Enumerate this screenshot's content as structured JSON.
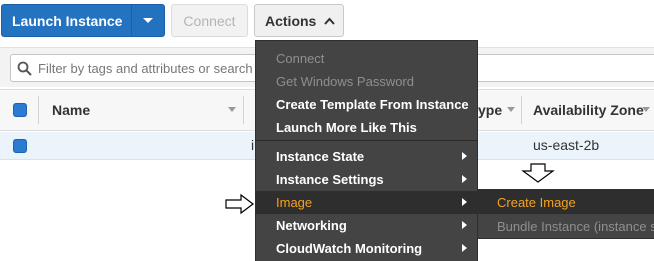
{
  "toolbar": {
    "launch_label": "Launch Instance",
    "connect_label": "Connect",
    "actions_label": "Actions"
  },
  "filter": {
    "placeholder": "Filter by tags and attributes or search by keyword"
  },
  "table": {
    "columns": [
      "Name",
      "Instance Type",
      "Availability Zone"
    ],
    "visible_column_labels": {
      "name": "Name",
      "type_fragment": "ype",
      "zone": "Availability Zone"
    },
    "row": {
      "id_fragment": "i",
      "availability_zone": "us-east-2b"
    }
  },
  "actions_menu": {
    "items": [
      {
        "label": "Connect",
        "state": "disabled"
      },
      {
        "label": "Get Windows Password",
        "state": "disabled"
      },
      {
        "label": "Create Template From Instance",
        "state": "enabled"
      },
      {
        "label": "Launch More Like This",
        "state": "enabled"
      },
      {
        "label": "Instance State",
        "state": "submenu"
      },
      {
        "label": "Instance Settings",
        "state": "submenu"
      },
      {
        "label": "Image",
        "state": "active-submenu"
      },
      {
        "label": "Networking",
        "state": "submenu"
      },
      {
        "label": "CloudWatch Monitoring",
        "state": "submenu"
      }
    ]
  },
  "image_submenu": {
    "items": [
      {
        "label": "Create Image",
        "state": "active"
      },
      {
        "label": "Bundle Instance (instance s",
        "state": "disabled"
      }
    ]
  },
  "colors": {
    "primary_button": "#2373c0",
    "menu_bg": "#444444",
    "menu_highlight": "#f6a11e",
    "selected_row": "#ebf4fb"
  },
  "icons": {
    "search": "search-icon",
    "dropdown": "chevron-down-icon",
    "actions_caret": "chevron-up-icon",
    "submenu": "chevron-right-icon",
    "annotation_arrow_right": "arrow-right-outline-icon",
    "annotation_arrow_down": "arrow-down-outline-icon"
  }
}
